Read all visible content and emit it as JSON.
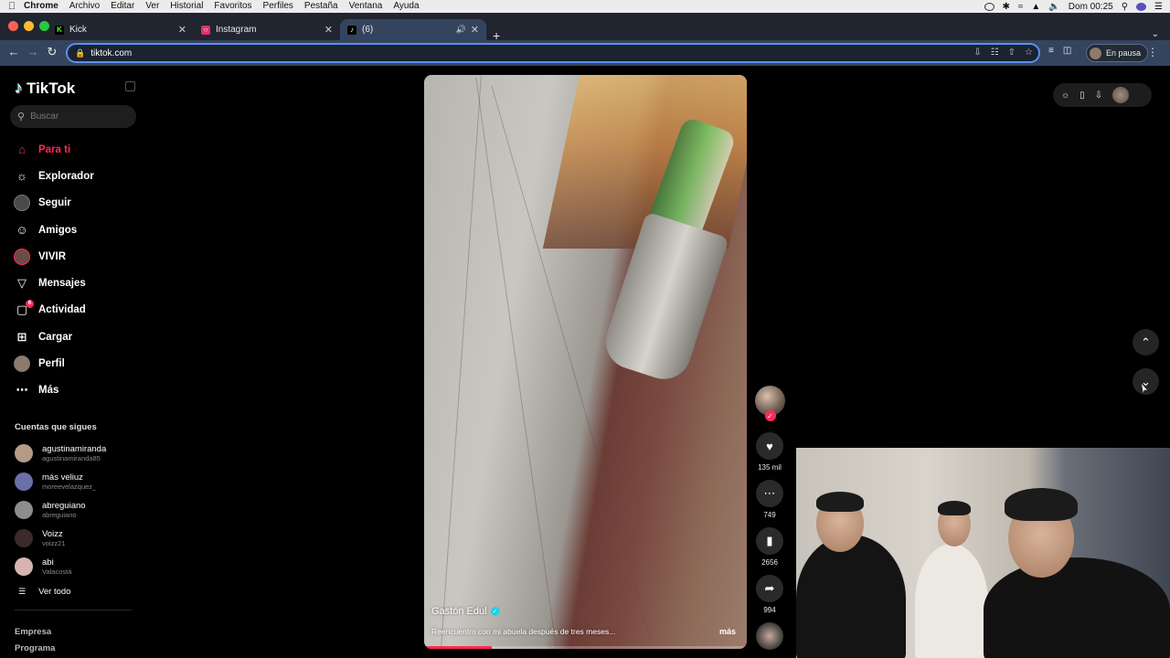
{
  "os_menubar": {
    "app": "Chrome",
    "menus": [
      "Archivo",
      "Editar",
      "Ver",
      "Historial",
      "Favoritos",
      "Perfiles",
      "Pestaña",
      "Ventana",
      "Ayuda"
    ],
    "clock": "Dom 00:25"
  },
  "browser": {
    "tabs": [
      {
        "title": "Kick",
        "favicon": "kick-logo",
        "color": "#53fc18"
      },
      {
        "title": "Instagram",
        "favicon": "instagram-logo",
        "color": "#e1306c"
      },
      {
        "title": "(6)",
        "favicon": "tiktok-logo",
        "color": "#ffffff",
        "active": true
      }
    ],
    "url": "tiktok.com",
    "profile_status": "En pausa"
  },
  "tiktok": {
    "logo_text": "TikTok",
    "search_placeholder": "Buscar",
    "nav": [
      {
        "label": "Para ti",
        "icon": "home-icon",
        "active": true
      },
      {
        "label": "Explorador",
        "icon": "compass-icon"
      },
      {
        "label": "Seguir",
        "icon": "following-avatar-icon"
      },
      {
        "label": "Amigos",
        "icon": "friends-icon"
      },
      {
        "label": "VIVIR",
        "icon": "live-avatar-icon"
      },
      {
        "label": "Mensajes",
        "icon": "send-icon"
      },
      {
        "label": "Actividad",
        "icon": "activity-icon",
        "badge": "6"
      },
      {
        "label": "Cargar",
        "icon": "upload-icon"
      },
      {
        "label": "Perfil",
        "icon": "profile-avatar-icon"
      },
      {
        "label": "Más",
        "icon": "more-icon"
      }
    ],
    "following_title": "Cuentas que sigues",
    "following": [
      {
        "name": "agustinamiranda",
        "handle": "agustinamiranda85",
        "color": "#b59b86"
      },
      {
        "name": "más veliuz",
        "handle": "moreevelazquez_",
        "color": "#6a6fa8"
      },
      {
        "name": "abreguiano",
        "handle": "abreguiano",
        "color": "#8d8d8d"
      },
      {
        "name": "Voizz",
        "handle": "voizz21",
        "color": "#3a2a2a"
      },
      {
        "name": "abi",
        "handle": "Valacostá",
        "color": "#d8b4b0"
      }
    ],
    "see_all": "Ver todo",
    "footer": [
      "Empresa",
      "Programa"
    ],
    "video": {
      "author": "Gastón Edul",
      "verified": true,
      "description": "Reencuentro con mi abuela después de tres meses...",
      "more": "más",
      "progress": 0.21
    },
    "actions": {
      "likes": "135 mil",
      "comments": "749",
      "saves": "2656",
      "shares": "994"
    }
  },
  "colors": {
    "accent": "#fe2c55",
    "tab_active": "#35445e",
    "omnibox_focus": "#5b8ff0"
  }
}
